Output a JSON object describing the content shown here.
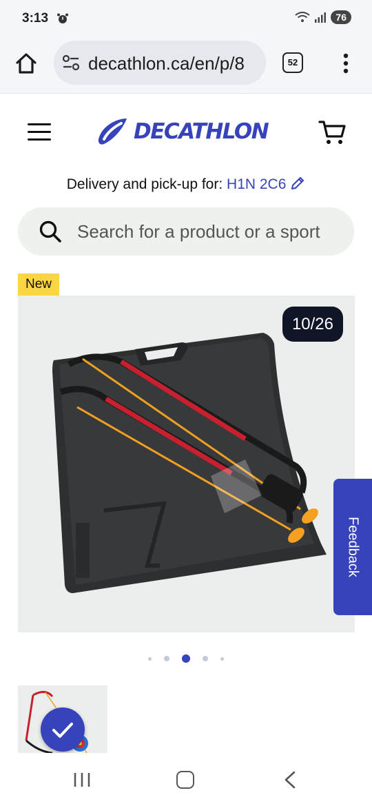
{
  "status_bar": {
    "time": "3:13",
    "battery": "76",
    "icons": [
      "alarm-icon",
      "wifi-icon",
      "signal-icon",
      "battery-icon"
    ]
  },
  "browser": {
    "url": "decathlon.ca/en/p/8",
    "tab_count": "52",
    "icons": [
      "home-icon",
      "site-settings-icon",
      "tabs-icon",
      "more-vert-icon"
    ]
  },
  "header": {
    "logo_text": "DECATHLON",
    "icons": [
      "hamburger-menu-icon",
      "logo-mark-icon",
      "cart-icon"
    ]
  },
  "delivery": {
    "label": "Delivery and pick-up for:",
    "postal_code": "H1N 2C6",
    "icon": "pencil-icon"
  },
  "search": {
    "placeholder": "Search for a product or a sport",
    "icon": "search-icon"
  },
  "product": {
    "badge": "New",
    "image_counter": "10/26",
    "carousel_active_index": 2,
    "carousel_dot_count": 5
  },
  "feedback": {
    "label": "Feedback"
  },
  "colors": {
    "brand": "#3643ba",
    "badge": "#fcd543",
    "counter_bg": "#101626"
  },
  "nav": {
    "icons": [
      "recent-apps-icon",
      "home-nav-icon",
      "back-icon"
    ]
  }
}
